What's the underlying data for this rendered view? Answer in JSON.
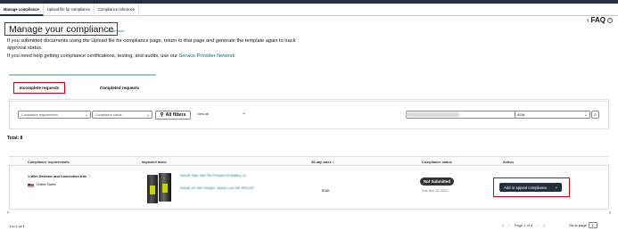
{
  "tabs": [
    {
      "label": "Manage compliance",
      "active": true
    },
    {
      "label": "Upload file for compliance",
      "active": false
    },
    {
      "label": "Compliance reference",
      "active": false
    }
  ],
  "header": {
    "title": "Manage your compliance",
    "learn_more": "Learn more",
    "faq": "FAQ"
  },
  "info": {
    "line1": "If you submitted documents using the Upload file for compliance page, return to that page and generate the template again to track approval status.",
    "line2_prefix": "If you need help getting compliance certifications, testing, and audits, use our ",
    "line2_link": "Service Provider Network"
  },
  "request_tabs": {
    "incomplete": "Incomplete requests",
    "completed": "Completed requests"
  },
  "filters": {
    "requirements_placeholder": "Compliance requirements",
    "status_placeholder": "Compliance status",
    "all_filters": "All filters",
    "view": "View all",
    "search_type": "ASIN"
  },
  "total": "Total: 8",
  "table": {
    "headers": {
      "requirements": "Compliance requirements",
      "items": "Impacted items",
      "sales": "30-day sales",
      "status": "Compliance status",
      "action": "Action"
    },
    "rows": [
      {
        "requirement": "1-Wire Detector and Connection Kits",
        "country": "United States",
        "item_line1": "Industr Safe 185 700 Photoell Kit Battery 12",
        "item_line2": "Industr 24 Volt Charger, Safety Lock 5/8 ZR/COO",
        "sales": "$166",
        "status": "Not Submitted",
        "status_date": "Due Nov 13, 2022",
        "action": "Add or appeal compliance"
      }
    ]
  },
  "pagination": {
    "summary": "1 to 1 of 1",
    "page_text": "Page 1 of 8",
    "goto_label": "Go to page",
    "goto_value": "1"
  },
  "colors": {
    "highlight": "#d0021b",
    "link": "#007185",
    "primary_dark": "#232f3e"
  }
}
